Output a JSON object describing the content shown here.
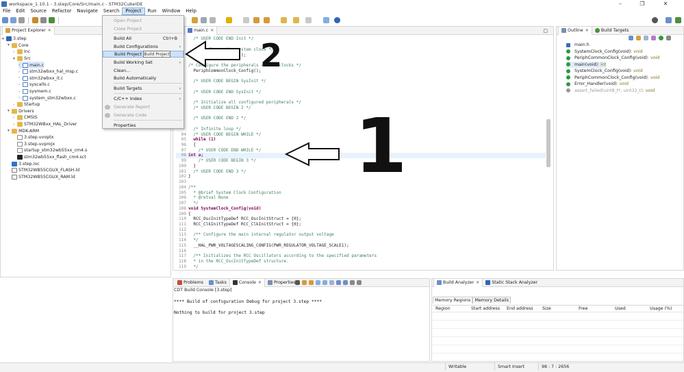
{
  "window": {
    "title": "workspace_1.10.1 - 3.step/Core/Src/main.c - STM32CubeIDE",
    "minimize": "–",
    "maximize": "❐",
    "close": "✕"
  },
  "menubar": [
    "File",
    "Edit",
    "Source",
    "Refactor",
    "Navigate",
    "Search",
    "Project",
    "Run",
    "Window",
    "Help"
  ],
  "project_menu": {
    "items": [
      {
        "label": "Open Project",
        "shortcut": "",
        "disabled": true,
        "submenu": false
      },
      {
        "label": "Close Project",
        "shortcut": "",
        "disabled": true,
        "submenu": false
      },
      {
        "label": "Build All",
        "shortcut": "Ctrl+B",
        "disabled": false,
        "submenu": false
      },
      {
        "label": "Build Configurations",
        "shortcut": "",
        "disabled": false,
        "submenu": true
      },
      {
        "label": "Build Project",
        "shortcut": "",
        "disabled": false,
        "submenu": false
      },
      {
        "label": "Build Working Set",
        "shortcut": "",
        "disabled": false,
        "submenu": true
      },
      {
        "label": "Clean...",
        "shortcut": "",
        "disabled": false,
        "submenu": false
      },
      {
        "label": "Build Automatically",
        "shortcut": "",
        "disabled": false,
        "submenu": false
      },
      {
        "label": "Build Targets",
        "shortcut": "",
        "disabled": false,
        "submenu": true
      },
      {
        "label": "C/C++ Index",
        "shortcut": "",
        "disabled": false,
        "submenu": true
      },
      {
        "label": "Generate Report",
        "shortcut": "",
        "disabled": true,
        "submenu": false
      },
      {
        "label": "Generate Code",
        "shortcut": "",
        "disabled": true,
        "submenu": false
      },
      {
        "label": "Properties",
        "shortcut": "",
        "disabled": false,
        "submenu": false
      }
    ],
    "tooltip": "Build Project"
  },
  "project_explorer": {
    "tab_label": "Project Explorer",
    "rows": [
      {
        "label": "3.step",
        "type": "proj",
        "level": 0,
        "arrow": "▾"
      },
      {
        "label": "Core",
        "type": "folder",
        "level": 1,
        "arrow": "▾"
      },
      {
        "label": "Inc",
        "type": "folder",
        "level": 2,
        "arrow": "›"
      },
      {
        "label": "Src",
        "type": "folder",
        "level": 2,
        "arrow": "▾"
      },
      {
        "label": "main.c",
        "type": "cfile",
        "level": 3,
        "arrow": "›"
      },
      {
        "label": "stm32wbxx_hal_msp.c",
        "type": "cfile",
        "level": 3,
        "arrow": "›"
      },
      {
        "label": "stm32wbxx_it.c",
        "type": "cfile",
        "level": 3,
        "arrow": "›"
      },
      {
        "label": "syscalls.c",
        "type": "cfile",
        "level": 3,
        "arrow": "›"
      },
      {
        "label": "sysmem.c",
        "type": "cfile",
        "level": 3,
        "arrow": "›"
      },
      {
        "label": "system_stm32wbxx.c",
        "type": "cfile",
        "level": 3,
        "arrow": "›"
      },
      {
        "label": "Startup",
        "type": "folder",
        "level": 2,
        "arrow": "›"
      },
      {
        "label": "Drivers",
        "type": "folder",
        "level": 1,
        "arrow": "▾"
      },
      {
        "label": "CMSIS",
        "type": "folder",
        "level": 2,
        "arrow": "›"
      },
      {
        "label": "STM32WBxx_HAL_Driver",
        "type": "folder",
        "level": 2,
        "arrow": "›"
      },
      {
        "label": "MDK-ARM",
        "type": "folder",
        "level": 1,
        "arrow": "▾"
      },
      {
        "label": "3.step.uvoptx",
        "type": "sfile",
        "level": 2,
        "arrow": ""
      },
      {
        "label": "3.step.uvprojx",
        "type": "sfile",
        "level": 2,
        "arrow": ""
      },
      {
        "label": "startup_stm32wb55xx_cm4.s",
        "type": "sfile",
        "level": 2,
        "arrow": ""
      },
      {
        "label": "stm32wb55xx_flash_cm4.sct",
        "type": "sct",
        "level": 2,
        "arrow": ""
      },
      {
        "label": "3.step.ioc",
        "type": "ioc",
        "level": 1,
        "arrow": ""
      },
      {
        "label": "STM32WB55CGUX_FLASH.ld",
        "type": "ld",
        "level": 1,
        "arrow": ""
      },
      {
        "label": "STM32WB55CGUX_RAM.ld",
        "type": "ld",
        "level": 1,
        "arrow": ""
      }
    ]
  },
  "editor": {
    "tab_label": "main.c",
    "lines": [
      {
        "n": "",
        "text": "  /* USER CODE END Init */",
        "cls": "cm"
      },
      {
        "n": "",
        "text": "",
        "cls": "code"
      },
      {
        "n": "",
        "text": "  /* Configure the system clock */",
        "cls": "cm"
      },
      {
        "n": "",
        "text": "  SystemClock_Config();",
        "cls": "code"
      },
      {
        "n": "",
        "text": "",
        "cls": "code"
      },
      {
        "n": "",
        "text": "/* Configure the peripherals common clocks */",
        "cls": "cm"
      },
      {
        "n": "",
        "text": "  PeriphCommonClock_Config();",
        "cls": "code"
      },
      {
        "n": "",
        "text": "",
        "cls": "code"
      },
      {
        "n": "",
        "text": "  /* USER CODE BEGIN SysInit */",
        "cls": "cm"
      },
      {
        "n": "",
        "text": "",
        "cls": "code"
      },
      {
        "n": "",
        "text": "  /* USER CODE END SysInit */",
        "cls": "cm"
      },
      {
        "n": "",
        "text": "",
        "cls": "code"
      },
      {
        "n": "",
        "text": "  /* Initialize all configured peripherals */",
        "cls": "cm"
      },
      {
        "n": "",
        "text": "  /* USER CODE BEGIN 2 */",
        "cls": "cm"
      },
      {
        "n": "",
        "text": "",
        "cls": "code"
      },
      {
        "n": "",
        "text": "  /* USER CODE END 2 */",
        "cls": "cm"
      },
      {
        "n": "",
        "text": "",
        "cls": "code"
      },
      {
        "n": "",
        "text": "  /* Infinite loop */",
        "cls": "cm"
      },
      {
        "n": "94",
        "text": "  /* USER CODE BEGIN WHILE */",
        "cls": "cm"
      },
      {
        "n": "95",
        "text": "  while (1)",
        "cls": "kw"
      },
      {
        "n": "96",
        "text": "  {",
        "cls": "code"
      },
      {
        "n": "97",
        "text": "    /* USER CODE END WHILE */",
        "cls": "cm"
      },
      {
        "n": "98",
        "text": "int a;",
        "cls": "kw"
      },
      {
        "n": "99",
        "text": "    /* USER CODE BEGIN 3 */",
        "cls": "cm"
      },
      {
        "n": "100",
        "text": "  }",
        "cls": "code"
      },
      {
        "n": "101",
        "text": "  /* USER CODE END 3 */",
        "cls": "cm"
      },
      {
        "n": "102",
        "text": "}",
        "cls": "code"
      },
      {
        "n": "103",
        "text": "",
        "cls": "code"
      },
      {
        "n": "104",
        "text": "/**",
        "cls": "cm"
      },
      {
        "n": "105",
        "text": "  * @brief System Clock Configuration",
        "cls": "cm"
      },
      {
        "n": "106",
        "text": "  * @retval None",
        "cls": "cm"
      },
      {
        "n": "107",
        "text": "  */",
        "cls": "cm"
      },
      {
        "n": "108",
        "text": "void SystemClock_Config(void)",
        "cls": "kw"
      },
      {
        "n": "109",
        "text": "{",
        "cls": "code"
      },
      {
        "n": "110",
        "text": "  RCC_OscInitTypeDef RCC_OscInitStruct = {0};",
        "cls": "code"
      },
      {
        "n": "111",
        "text": "  RCC_ClkInitTypeDef RCC_ClkInitStruct = {0};",
        "cls": "code"
      },
      {
        "n": "112",
        "text": "",
        "cls": "code"
      },
      {
        "n": "113",
        "text": "  /** Configure the main internal regulator output voltage",
        "cls": "cm"
      },
      {
        "n": "114",
        "text": "  */",
        "cls": "cm"
      },
      {
        "n": "115",
        "text": "  __HAL_PWR_VOLTAGESCALING_CONFIG(PWR_REGULATOR_VOLTAGE_SCALE1);",
        "cls": "code"
      },
      {
        "n": "116",
        "text": "",
        "cls": "code"
      },
      {
        "n": "117",
        "text": "  /** Initializes the RCC Oscillators according to the specified parameters",
        "cls": "cm"
      },
      {
        "n": "118",
        "text": "  * in the RCC_OscInitTypeDef structure.",
        "cls": "cm"
      },
      {
        "n": "119",
        "text": "  */",
        "cls": "cm"
      }
    ]
  },
  "annotations": {
    "one": "1",
    "two": "2"
  },
  "outline": {
    "tabs": [
      "Outline",
      "Build Targets"
    ],
    "rows": [
      {
        "label": "main.h",
        "ret": "",
        "color": "#3a6cb5"
      },
      {
        "label": "SystemClock_Config(void)",
        "ret": " : void",
        "color": "#2b9a3f"
      },
      {
        "label": "PeriphCommonClock_Config(void)",
        "ret": " : void",
        "color": "#2b9a3f"
      },
      {
        "label": "main(void)",
        "ret": " : int",
        "color": "#2b9a3f"
      },
      {
        "label": "SystemClock_Config(void)",
        "ret": " : void",
        "color": "#2b9a3f"
      },
      {
        "label": "PeriphCommonClock_Config(void)",
        "ret": " : void",
        "color": "#2b9a3f"
      },
      {
        "label": "Error_Handler(void)",
        "ret": " : void",
        "color": "#2b9a3f"
      },
      {
        "label": "assert_failed(uint8_t*, uint32_t)",
        "ret": " : void",
        "color": "#9a9a9a"
      }
    ]
  },
  "console": {
    "tabs": [
      "Problems",
      "Tasks",
      "Console",
      "Properties"
    ],
    "subtitle": "CDT Build Console [3.step]",
    "line1": "**** Build of configuration Debug for project 3.step ****",
    "line2": "Nothing to build for project 3.step"
  },
  "build_analyzer": {
    "tabs": [
      "Build Analyzer",
      "Static Stack Analyzer"
    ],
    "subtabs": [
      "Memory Regions",
      "Memory Details"
    ],
    "columns": [
      "Region",
      "Start address",
      "End address",
      "Size",
      "Free",
      "Used",
      "Usage (%)"
    ]
  },
  "status": {
    "writable": "Writable",
    "insert": "Smart Insert",
    "position": "98 : 7 : 2656"
  }
}
